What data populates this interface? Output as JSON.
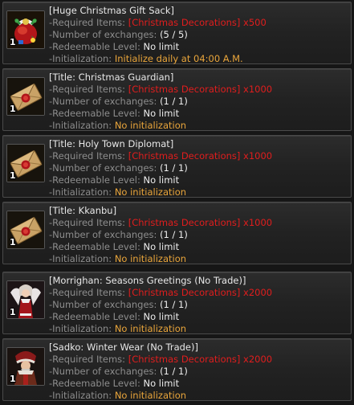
{
  "entries": [
    {
      "title": "[Huge Christmas Gift Sack]",
      "icon": "gift-sack-icon",
      "quantity": "1",
      "required_label": "-Required Items:",
      "required_value": "[Christmas Decorations] x500",
      "exchanges_label": "-Number of exchanges:",
      "exchanges_value": "(5 / 5)",
      "level_label": "-Redeemable Level:",
      "level_value": "No limit",
      "init_label": "-Initialization:",
      "init_value": "Initialize daily at 04:00 A.M."
    },
    {
      "title": "[Title: Christmas Guardian]",
      "icon": "sealed-letter-icon",
      "quantity": "1",
      "required_label": "-Required Items:",
      "required_value": "[Christmas Decorations] x1000",
      "exchanges_label": "-Number of exchanges:",
      "exchanges_value": "(1 / 1)",
      "level_label": "-Redeemable Level:",
      "level_value": "No limit",
      "init_label": "-Initialization:",
      "init_value": "No initialization"
    },
    {
      "title": "[Title: Holy Town Diplomat]",
      "icon": "sealed-letter-icon",
      "quantity": "1",
      "required_label": "-Required Items:",
      "required_value": "[Christmas Decorations] x1000",
      "exchanges_label": "-Number of exchanges:",
      "exchanges_value": "(1 / 1)",
      "level_label": "-Redeemable Level:",
      "level_value": "No limit",
      "init_label": "-Initialization:",
      "init_value": "No initialization"
    },
    {
      "title": "[Title: Kkanbu]",
      "icon": "sealed-letter-icon",
      "quantity": "1",
      "required_label": "-Required Items:",
      "required_value": "[Christmas Decorations] x1000",
      "exchanges_label": "-Number of exchanges:",
      "exchanges_value": "(1 / 1)",
      "level_label": "-Redeemable Level:",
      "level_value": "No limit",
      "init_label": "-Initialization:",
      "init_value": "No initialization"
    },
    {
      "title": "[Morrighan: Seasons Greetings (No Trade)]",
      "icon": "morrighan-outfit-icon",
      "quantity": "1",
      "required_label": "-Required Items:",
      "required_value": "[Christmas Decorations] x2000",
      "exchanges_label": "-Number of exchanges:",
      "exchanges_value": "(1 / 1)",
      "level_label": "-Redeemable Level:",
      "level_value": "No limit",
      "init_label": "-Initialization:",
      "init_value": "No initialization"
    },
    {
      "title": "[Sadko: Winter Wear (No Trade)]",
      "icon": "sadko-outfit-icon",
      "quantity": "1",
      "required_label": "-Required Items:",
      "required_value": "[Christmas Decorations] x2000",
      "exchanges_label": "-Number of exchanges:",
      "exchanges_value": "(1 / 1)",
      "level_label": "-Redeemable Level:",
      "level_value": "No limit",
      "init_label": "-Initialization:",
      "init_value": "No initialization"
    }
  ]
}
